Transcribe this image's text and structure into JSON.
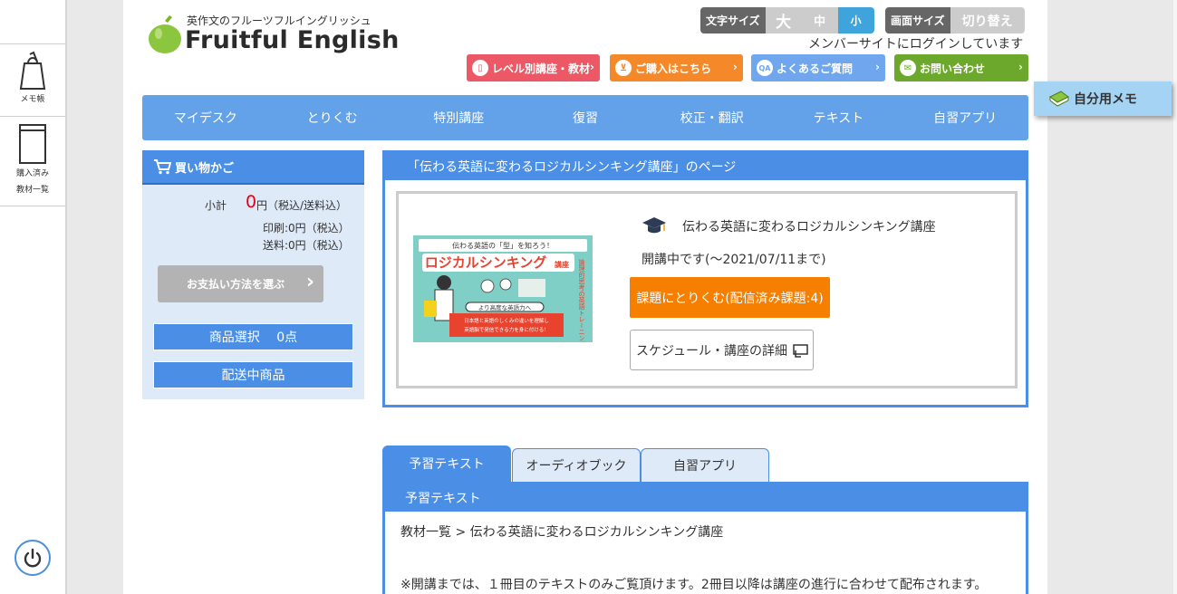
{
  "sidebar": {
    "memo_label": "メモ帳",
    "purchased_label_1": "購入済み",
    "purchased_label_2": "教材一覧"
  },
  "header": {
    "logo_subtitle": "英作文のフルーツフルイングリッシュ",
    "logo_title": "Fruitful English",
    "font_size_label": "文字サイズ",
    "font_sizes": [
      "大",
      "中",
      "小"
    ],
    "font_size_selected": "小",
    "screen_size_label": "画面サイズ",
    "screen_size_toggle": "切り替え",
    "login_note": "メンバーサイトにログインしています",
    "buttons": [
      {
        "label": "レベル別講座・教材",
        "color": "#ec5866"
      },
      {
        "label": "ご購入はこちら",
        "color": "#f5892a"
      },
      {
        "label": "よくあるご質問",
        "color": "#6fa6ee"
      },
      {
        "label": "お問い合わせ",
        "color": "#6ba82c"
      }
    ],
    "chevron": "›"
  },
  "memo_tab": {
    "label": "自分用メモ"
  },
  "nav": {
    "items": [
      "マイデスク",
      "とりくむ",
      "特別講座",
      "復習",
      "校正・翻訳",
      "テキスト",
      "自習アプリ"
    ]
  },
  "cart": {
    "title": "買い物かご",
    "subtotal_label": "小計",
    "subtotal_value": "0",
    "subtotal_unit": "円（税込/送料込）",
    "print_line": "印刷:0円（税込）",
    "shipping_line": "送料:0円（税込）",
    "pay_button": "お支払い方法を選ぶ",
    "select_items": "商品選択　 0点",
    "shipping_items": "配送中商品"
  },
  "course": {
    "page_title": "「伝わる英語に変わるロジカルシンキング講座」のページ",
    "title": "伝わる英語に変わるロジカルシンキング講座",
    "period": "開講中です(～2021/07/11まで)",
    "task_button": "課題にとりくむ(配信済み課題:4)",
    "schedule_button": "スケジュール・講座の詳細",
    "image_text": {
      "top": "伝わる英語の「型」を知ろう！",
      "main": "ロジカルシンキング",
      "main_suffix": "講座",
      "side": "論理的思考の英語トレーニング",
      "pill": "より高度な英語力へ",
      "bottom_1": "日本語と英語のしくみの違いを理解し",
      "bottom_2": "英語脳で発信できる力を身に付ける！"
    }
  },
  "tabs": {
    "items": [
      "予習テキスト",
      "オーディオブック",
      "自習アプリ"
    ],
    "active": "予習テキスト"
  },
  "text_panel": {
    "title": "予習テキスト",
    "breadcrumb": "教材一覧 > 伝わる英語に変わるロジカルシンキング講座",
    "notice": "※開講までは、１冊目のテキストのみご覧頂けます。2冊目以降は講座の進行に合わせて配布されます。"
  },
  "colors": {
    "accent": "#4a8ee6",
    "nav": "#63a1e8",
    "orange": "#f77f00",
    "subtotal_red": "#e60012"
  }
}
